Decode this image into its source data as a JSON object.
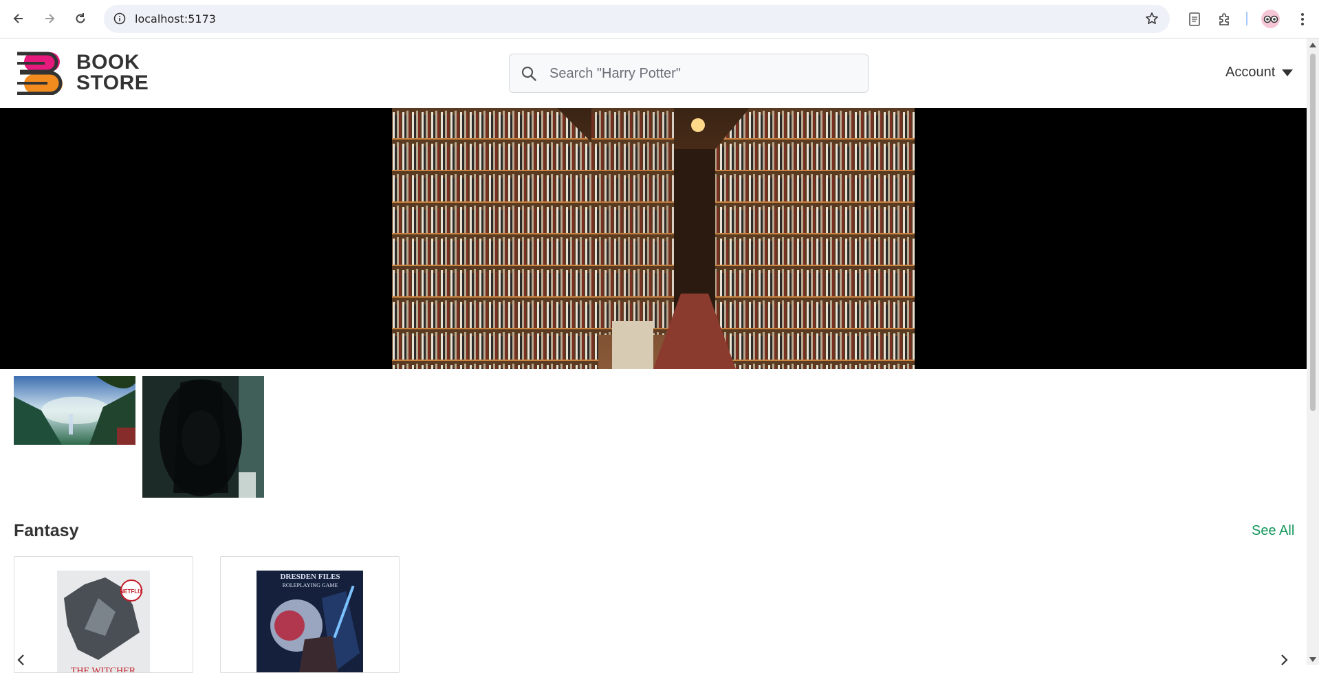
{
  "browser": {
    "url": "localhost:5173",
    "icons": [
      "back-arrow-icon",
      "forward-arrow-icon",
      "reload-icon",
      "site-info-icon",
      "bookmark-star-icon",
      "reading-list-icon",
      "extensions-icon",
      "profile-avatar-icon",
      "more-menu-icon"
    ]
  },
  "header": {
    "logo_line1": "BOOK",
    "logo_line2": "STORE",
    "search_placeholder": "Search \"Harry Potter\"",
    "account_label": "Account"
  },
  "section": {
    "title": "Fantasy",
    "see_all": "See All"
  },
  "books": [
    {
      "cover_text": "THE WITCHER",
      "badge": "NETFLIX"
    },
    {
      "cover_text": "DRESDEN FILES",
      "subtitle": "ROLEPLAYING GAME"
    }
  ],
  "colors": {
    "brand_pink": "#e6197d",
    "brand_orange": "#f28c1e",
    "accent_green": "#12965a",
    "hero_bg": "#000000"
  }
}
